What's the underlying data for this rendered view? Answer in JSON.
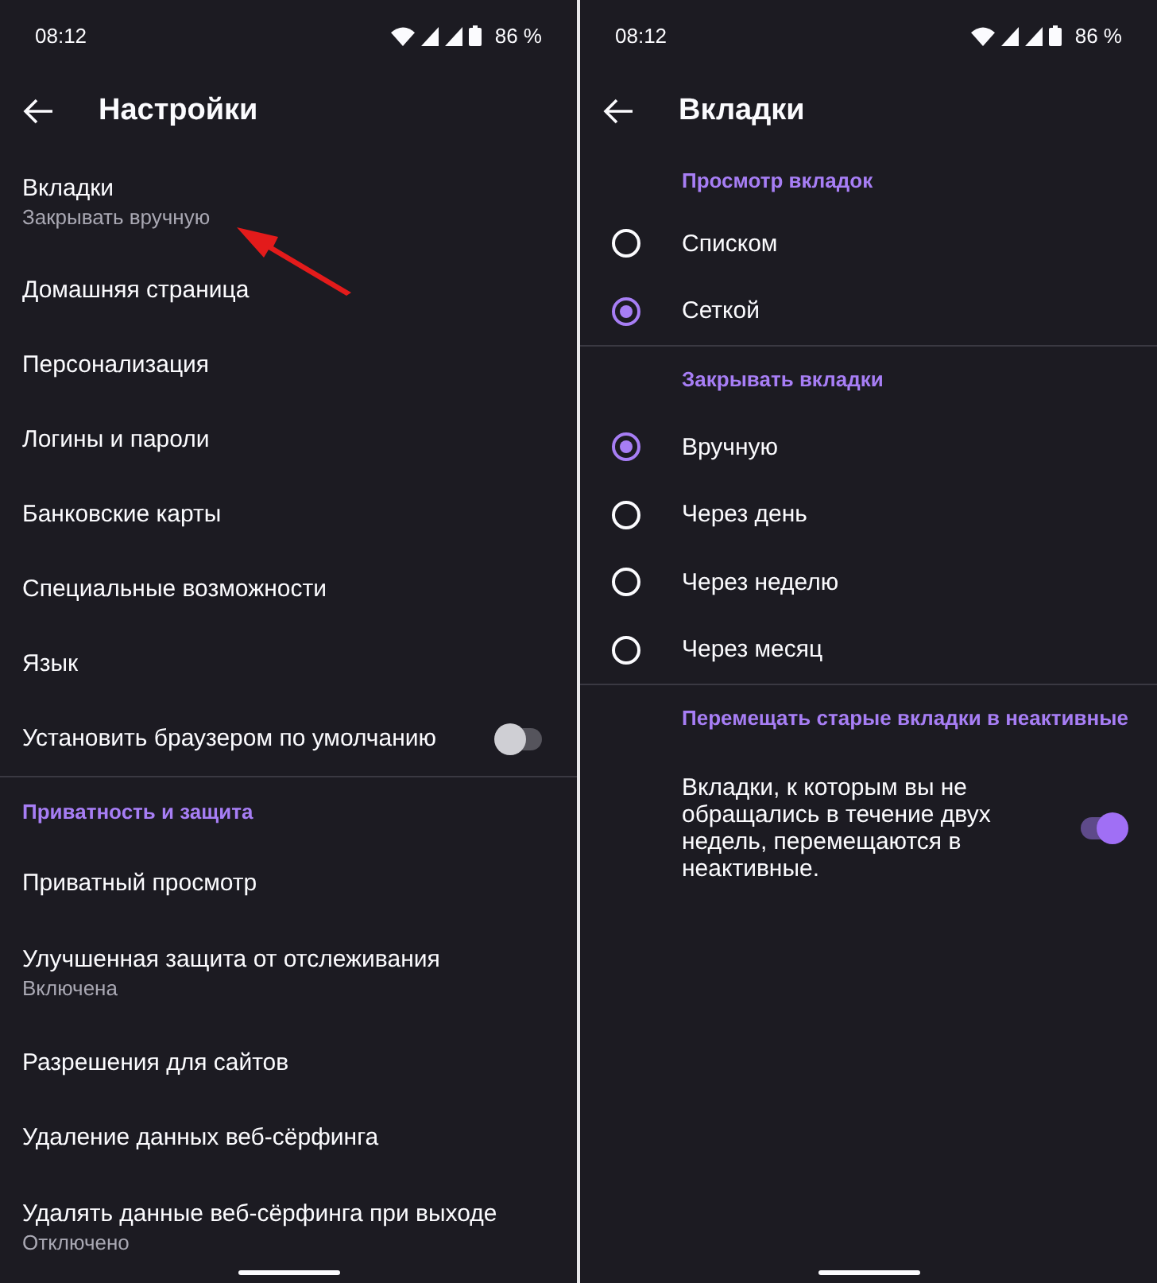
{
  "screens": [
    {
      "status_bar": {
        "time": "08:12",
        "battery": "86 %"
      },
      "title": "Настройки",
      "items": [
        {
          "kind": "row",
          "title": "Вкладки",
          "subtitle": "Закрывать вручную"
        },
        {
          "kind": "row",
          "title": "Домашняя страница"
        },
        {
          "kind": "row",
          "title": "Персонализация"
        },
        {
          "kind": "row",
          "title": "Логины и пароли"
        },
        {
          "kind": "row",
          "title": "Банковские карты"
        },
        {
          "kind": "row",
          "title": "Специальные возможности"
        },
        {
          "kind": "row",
          "title": "Язык"
        },
        {
          "kind": "switch",
          "title": "Установить браузером по умолчанию",
          "on": false
        },
        {
          "kind": "section",
          "title": "Приватность и защита"
        },
        {
          "kind": "row",
          "title": "Приватный просмотр"
        },
        {
          "kind": "row",
          "title": "Улучшенная защита от отслеживания",
          "subtitle": "Включена"
        },
        {
          "kind": "row",
          "title": "Разрешения для сайтов"
        },
        {
          "kind": "row",
          "title": "Удаление данных веб-сёрфинга"
        },
        {
          "kind": "row",
          "title": "Удалять данные веб-сёрфинга при выходе",
          "subtitle": "Отключено"
        }
      ]
    },
    {
      "status_bar": {
        "time": "08:12",
        "battery": "86 %"
      },
      "title": "Вкладки",
      "items": [
        {
          "kind": "section",
          "title": "Просмотр вкладок"
        },
        {
          "kind": "radio",
          "title": "Списком",
          "selected": false
        },
        {
          "kind": "radio",
          "title": "Сеткой",
          "selected": true
        },
        {
          "kind": "section",
          "title": "Закрывать вкладки"
        },
        {
          "kind": "radio",
          "title": "Вручную",
          "selected": true
        },
        {
          "kind": "radio",
          "title": "Через день",
          "selected": false
        },
        {
          "kind": "radio",
          "title": "Через неделю",
          "selected": false
        },
        {
          "kind": "radio",
          "title": "Через месяц",
          "selected": false
        },
        {
          "kind": "section",
          "title": "Перемещать старые вкладки в неактивные"
        },
        {
          "kind": "switch",
          "title": "Вкладки, к которым вы не обращались в течение двух недель, перемещаются в неактивные.",
          "on": true
        }
      ]
    }
  ]
}
